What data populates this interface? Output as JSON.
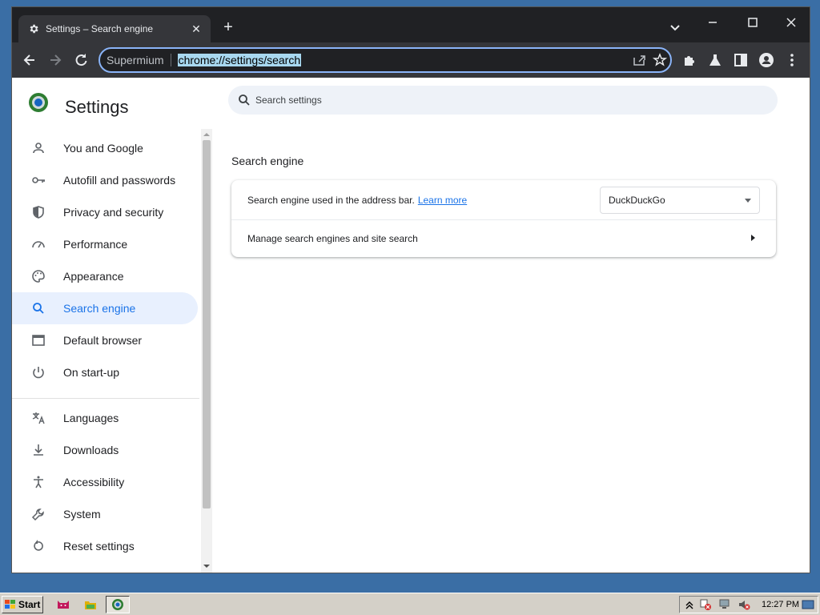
{
  "tab": {
    "title": "Settings – Search engine",
    "close": "✕"
  },
  "newtab": {
    "label": "+"
  },
  "omnibox": {
    "site_name": "Supermium",
    "url": "chrome://settings/search"
  },
  "page": {
    "title": "Settings",
    "search_placeholder": "Search settings",
    "section_title": "Search engine",
    "row1_text": "Search engine used in the address bar.",
    "learn_more": "Learn more",
    "selected_engine": "DuckDuckGo",
    "row2_text": "Manage search engines and site search"
  },
  "sidebar": {
    "items": [
      {
        "label": "You and Google",
        "icon": "person-icon"
      },
      {
        "label": "Autofill and passwords",
        "icon": "key-icon"
      },
      {
        "label": "Privacy and security",
        "icon": "shield-icon"
      },
      {
        "label": "Performance",
        "icon": "gauge-icon"
      },
      {
        "label": "Appearance",
        "icon": "palette-icon"
      },
      {
        "label": "Search engine",
        "icon": "search-icon",
        "active": true
      },
      {
        "label": "Default browser",
        "icon": "browser-window-icon"
      },
      {
        "label": "On start-up",
        "icon": "power-icon"
      },
      {
        "label": "Languages",
        "icon": "translate-icon"
      },
      {
        "label": "Downloads",
        "icon": "download-icon"
      },
      {
        "label": "Accessibility",
        "icon": "accessibility-icon"
      },
      {
        "label": "System",
        "icon": "wrench-icon"
      },
      {
        "label": "Reset settings",
        "icon": "reset-icon"
      }
    ]
  },
  "taskbar": {
    "start_label": "Start",
    "clock": "12:27 PM"
  },
  "colors": {
    "accent": "#1a73e8",
    "active_bg": "#e8f0fe",
    "tabstrip": "#202124",
    "toolbar": "#35363a",
    "desktop": "#3a6ea5"
  }
}
